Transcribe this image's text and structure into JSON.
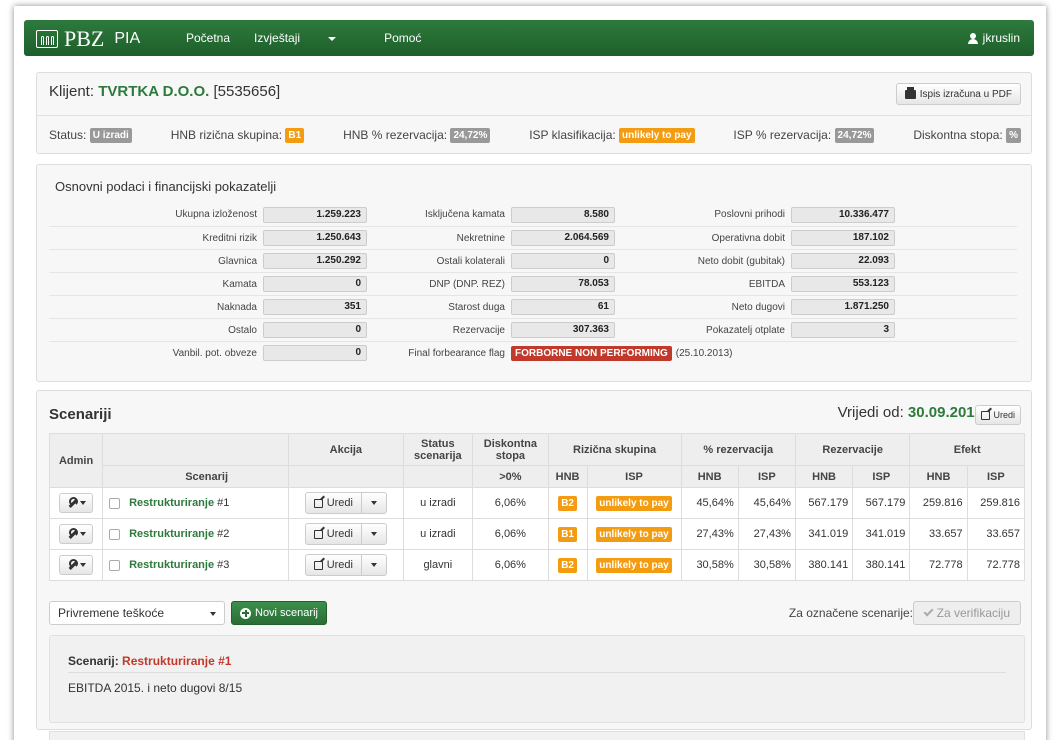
{
  "nav": {
    "brand": "PBZ",
    "app": "PIA",
    "items": [
      {
        "label": "Početna"
      },
      {
        "label": "Izvještaji",
        "dropdown": true
      },
      {
        "label": "Pomoć"
      }
    ],
    "user": "jkruslin"
  },
  "client": {
    "prefix": "Klijent:",
    "name": "TVRTKA D.O.O.",
    "id": "[5535656]",
    "pdf_button": "Ispis izračuna u PDF",
    "status": [
      {
        "label": "Status:",
        "value": "U izradi",
        "color": "grey"
      },
      {
        "label": "HNB rizična skupina:",
        "value": "B1",
        "color": "orange"
      },
      {
        "label": "HNB % rezervacija:",
        "value": "24,72%",
        "color": "grey"
      },
      {
        "label": "ISP klasifikacija:",
        "value": "unlikely to pay",
        "color": "orange"
      },
      {
        "label": "ISP % rezervacija:",
        "value": "24,72%",
        "color": "grey"
      },
      {
        "label": "Diskontna stopa:",
        "value": "%",
        "color": "grey"
      }
    ]
  },
  "financials": {
    "title": "Osnovni podaci i financijski pokazatelji",
    "rows": [
      [
        {
          "k": "Ukupna izloženost",
          "v": "1.259.223"
        },
        {
          "k": "Isključena kamata",
          "v": "8.580"
        },
        {
          "k": "Poslovni prihodi",
          "v": "10.336.477"
        }
      ],
      [
        {
          "k": "Kreditni rizik",
          "v": "1.250.643"
        },
        {
          "k": "Nekretnine",
          "v": "2.064.569"
        },
        {
          "k": "Operativna dobit",
          "v": "187.102"
        }
      ],
      [
        {
          "k": "Glavnica",
          "v": "1.250.292"
        },
        {
          "k": "Ostali kolaterali",
          "v": "0"
        },
        {
          "k": "Neto dobit (gubitak)",
          "v": "22.093"
        }
      ],
      [
        {
          "k": "Kamata",
          "v": "0"
        },
        {
          "k": "DNP (DNP. REZ)",
          "v": "78.053"
        },
        {
          "k": "EBITDA",
          "v": "553.123"
        }
      ],
      [
        {
          "k": "Naknada",
          "v": "351"
        },
        {
          "k": "Starost duga",
          "v": "61"
        },
        {
          "k": "Neto dugovi",
          "v": "1.871.250"
        }
      ],
      [
        {
          "k": "Ostalo",
          "v": "0"
        },
        {
          "k": "Rezervacije",
          "v": "307.363"
        },
        {
          "k": "Pokazatelj otplate",
          "v": "3"
        }
      ]
    ],
    "last_row": {
      "k1": "Vanbil. pot. obveze",
      "v1": "0",
      "k2": "Final forbearance flag",
      "flag": "FORBORNE NON PERFORMING",
      "flag_date": "(25.10.2013)"
    }
  },
  "scenarios": {
    "title": "Scenariji",
    "valid_prefix": "Vrijedi od:",
    "valid_date": "30.09.2015",
    "edit_label": "Uredi",
    "headers": {
      "admin": "Admin",
      "akcija": "Akcija",
      "status": "Status scenarija",
      "diskont": "Diskontna stopa",
      "rizicna": "Rizična skupina",
      "rez_pct": "% rezervacija",
      "rez": "Rezervacije",
      "efekt": "Efekt",
      "scenarij": "Scenarij",
      "diskont_sub": ">0%",
      "hnb": "HNB",
      "isp": "ISP"
    },
    "rows": [
      {
        "name": "Restrukturiranje",
        "num": "#1",
        "action": "Uredi",
        "status": "u izradi",
        "disc": "6,06%",
        "hnb_grp": "B2",
        "isp_grp": "unlikely to pay",
        "pct_hnb": "45,64%",
        "pct_isp": "45,64%",
        "rez_hnb": "567.179",
        "rez_isp": "567.179",
        "ef_hnb": "259.816",
        "ef_isp": "259.816"
      },
      {
        "name": "Restrukturiranje",
        "num": "#2",
        "action": "Uredi",
        "status": "u izradi",
        "disc": "6,06%",
        "hnb_grp": "B1",
        "isp_grp": "unlikely to pay",
        "pct_hnb": "27,43%",
        "pct_isp": "27,43%",
        "rez_hnb": "341.019",
        "rez_isp": "341.019",
        "ef_hnb": "33.657",
        "ef_isp": "33.657"
      },
      {
        "name": "Restrukturiranje",
        "num": "#3",
        "action": "Uredi",
        "status": "glavni",
        "disc": "6,06%",
        "hnb_grp": "B2",
        "isp_grp": "unlikely to pay",
        "pct_hnb": "30,58%",
        "pct_isp": "30,58%",
        "rez_hnb": "380.141",
        "rez_isp": "380.141",
        "ef_hnb": "72.778",
        "ef_isp": "72.778"
      }
    ],
    "select_value": "Privremene teškoće",
    "new_button": "Novi scenarij",
    "marked_label": "Za označene scenarije:",
    "verify_button": "Za verifikaciju",
    "detail": {
      "prefix": "Scenarij:",
      "name": "Restrukturiranje #1",
      "text": "EBITDA 2015. i neto dugovi 8/15"
    }
  },
  "colors": {
    "brand": "#2d7a3c",
    "orange": "#f39c12",
    "red": "#c0392b",
    "grey": "#999999"
  }
}
